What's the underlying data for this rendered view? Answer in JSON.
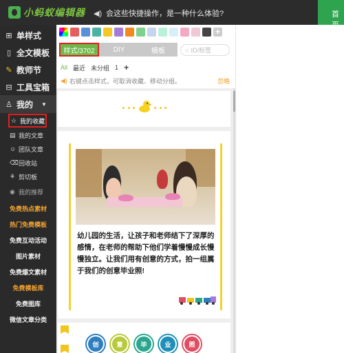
{
  "topbar": {
    "app_name": "小蚂蚁编辑器",
    "announcement": "会这些快捷操作，是一种什么体验?",
    "right_button": "首页"
  },
  "sidebar": {
    "main_items": [
      {
        "icon": "grid-icon",
        "label": "单样式"
      },
      {
        "icon": "document-icon",
        "label": "全文模板"
      },
      {
        "icon": "brush-icon",
        "label": "教师节"
      },
      {
        "icon": "toolbox-icon",
        "label": "工具宝箱"
      }
    ],
    "mine": {
      "label": "我的"
    },
    "sub_items": [
      {
        "icon": "star-icon",
        "label": "我的收藏"
      },
      {
        "icon": "article-icon",
        "label": "我的文章"
      },
      {
        "icon": "team-icon",
        "label": "团队文章"
      },
      {
        "icon": "trash-icon",
        "label": "回收站"
      },
      {
        "icon": "clipboard-icon",
        "label": "剪切板"
      },
      {
        "icon": "eye-icon",
        "label": "我的推荐"
      }
    ],
    "free_items": [
      {
        "label": "免费热点素材",
        "color": "orange"
      },
      {
        "label": "热门免费模板",
        "color": "orange"
      },
      {
        "label": "免费互动活动",
        "color": "white"
      },
      {
        "label": "图片素材",
        "color": "white"
      },
      {
        "label": "免费爆文素材",
        "color": "white"
      },
      {
        "label": "免费模板库",
        "color": "orange"
      },
      {
        "label": "免费图库",
        "color": "white"
      },
      {
        "label": "微信文章分类",
        "color": "white"
      }
    ]
  },
  "panel": {
    "swatches": [
      "#e85d5d",
      "#5b8fd8",
      "#4db2a3",
      "#f4c724",
      "#a57ad8",
      "#f0891e",
      "#7ed08c",
      "#c7d4ef",
      "#b9f2d6",
      "#d7f0f7",
      "#f3a9c2",
      "#eec9d4",
      "#444444"
    ],
    "tabs": {
      "styles": "样式/3702",
      "diy": "DIY",
      "template": "模板"
    },
    "search_placeholder": "ID/标签",
    "filters": {
      "all": "All",
      "recent": "最近",
      "ungrouped": "未分组",
      "group_one": "1"
    },
    "hint": "右键点击样式，可取消收藏、移动分组。",
    "ignore": "忽略"
  },
  "cards": {
    "caption": "幼儿园的生活，让孩子和老师结下了深厚的感情，在老师的帮助下他们学着慢慢成长慢慢独立。让我们用有创意的方式，拍一组属于我们的创意毕业照!",
    "circles": [
      {
        "char": "创",
        "color": "#2e7ec0"
      },
      {
        "char": "意",
        "color": "#b8c93a"
      },
      {
        "char": "毕",
        "color": "#2aa68e"
      },
      {
        "char": "业",
        "color": "#1f8fb8"
      },
      {
        "char": "照",
        "color": "#e04e63"
      }
    ]
  }
}
